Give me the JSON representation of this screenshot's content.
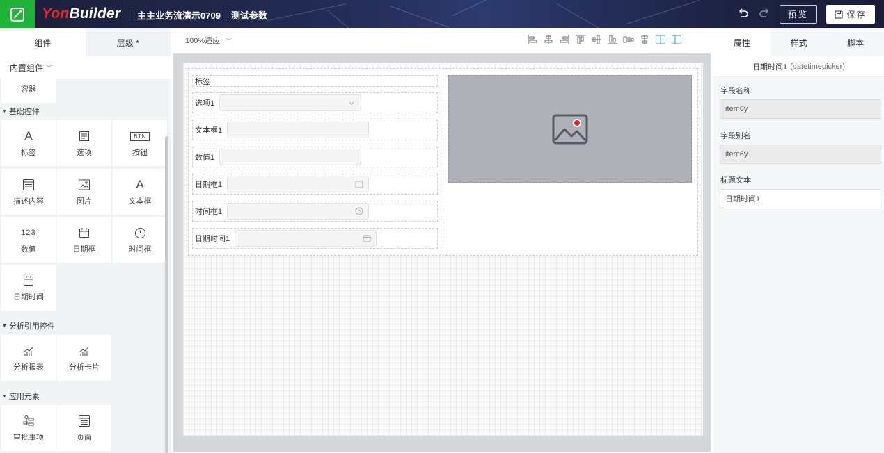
{
  "header": {
    "brand_prefix": "Yon",
    "brand_suffix": "Builder",
    "app_name": "主主业务流演示0709",
    "page_name": "测试参数",
    "preview_label": "预览",
    "save_label": "保存"
  },
  "left_panel": {
    "tabs": [
      {
        "label": "组件",
        "active": true
      },
      {
        "label": "层级 *",
        "active": false
      }
    ],
    "builtin_label": "内置组件",
    "container_label": "容器",
    "sections": {
      "basic": {
        "title": "基础控件",
        "items": [
          {
            "label": "标签",
            "icon": "letter-a-icon"
          },
          {
            "label": "选项",
            "icon": "list-icon"
          },
          {
            "label": "按钮",
            "icon": "btn-icon",
            "icon_text": "BTN"
          },
          {
            "label": "描述内容",
            "icon": "document-icon"
          },
          {
            "label": "图片",
            "icon": "image-icon"
          },
          {
            "label": "文本框",
            "icon": "letter-a-icon"
          },
          {
            "label": "数值",
            "icon": "number-icon",
            "icon_text": "123"
          },
          {
            "label": "日期框",
            "icon": "calendar-icon"
          },
          {
            "label": "时间框",
            "icon": "clock-icon"
          },
          {
            "label": "日期时间",
            "icon": "calendar-icon"
          }
        ]
      },
      "analytics": {
        "title": "分析引用控件",
        "items": [
          {
            "label": "分析报表",
            "icon": "chart-icon"
          },
          {
            "label": "分析卡片",
            "icon": "chart-icon"
          }
        ]
      },
      "app": {
        "title": "应用元素",
        "items": [
          {
            "label": "审批事项",
            "icon": "approval-icon"
          },
          {
            "label": "页面",
            "icon": "page-icon"
          }
        ]
      }
    }
  },
  "toolbar": {
    "zoom_label": "100%适应"
  },
  "canvas": {
    "label_row": "标签",
    "rows": [
      {
        "label": "选项1",
        "type": "select"
      },
      {
        "label": "文本框1",
        "type": "text"
      },
      {
        "label": "数值1",
        "type": "number"
      },
      {
        "label": "日期框1",
        "type": "date"
      },
      {
        "label": "时间框1",
        "type": "time"
      },
      {
        "label": "日期时间1",
        "type": "datetime"
      }
    ]
  },
  "right_panel": {
    "tabs": [
      {
        "label": "属性",
        "active": true
      },
      {
        "label": "样式",
        "active": false
      },
      {
        "label": "脚本",
        "active": false
      }
    ],
    "component_name": "日期时间1",
    "component_type": "(datetimepicker)",
    "props": [
      {
        "label": "字段名称",
        "value": "item6y",
        "disabled": true
      },
      {
        "label": "字段别名",
        "value": "item6y",
        "disabled": true
      },
      {
        "label": "标题文本",
        "value": "日期时间1",
        "disabled": false
      }
    ]
  },
  "colors": {
    "brand_green": "#1fb33a",
    "brand_red": "#e8262d",
    "header_bg": "#232a52",
    "accent_blue": "#3a8ee6"
  }
}
